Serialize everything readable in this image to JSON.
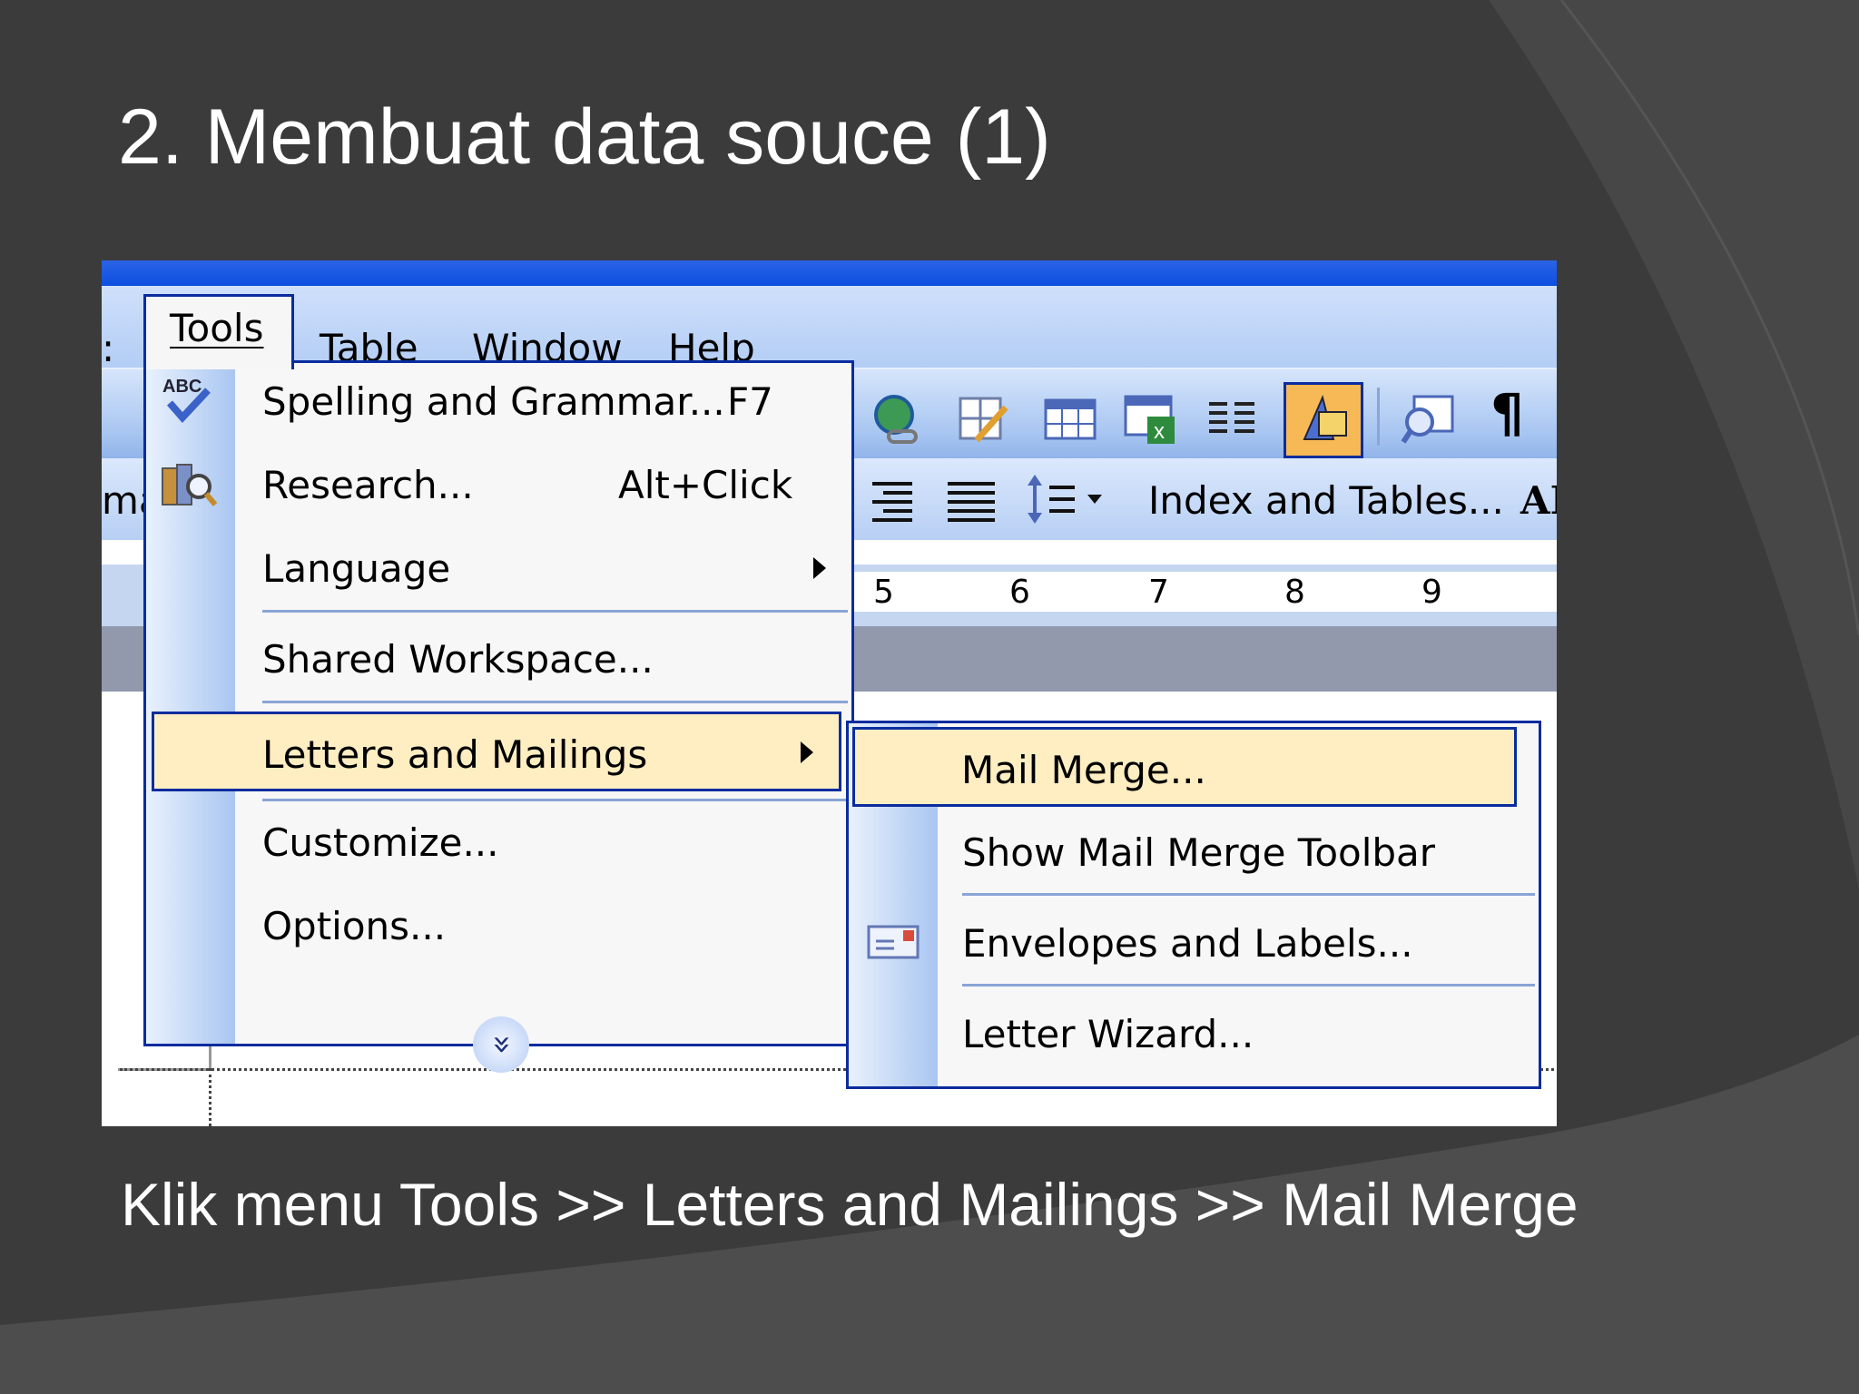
{
  "slide": {
    "title": "2. Membuat data souce (1)",
    "caption": "Klik menu Tools >> Letters and Mailings >> Mail Merge"
  },
  "menubar": {
    "items": [
      {
        "label": "Tools"
      },
      {
        "label": "Table"
      },
      {
        "label": "Window"
      },
      {
        "label": "Help"
      }
    ]
  },
  "tools_menu": {
    "items": [
      {
        "label": "Spelling and Grammar...",
        "shortcut": "F7",
        "icon": "spelling-icon"
      },
      {
        "label": "Research...",
        "shortcut": "Alt+Click",
        "icon": "research-icon"
      },
      {
        "label": "Language",
        "has_submenu": true
      },
      {
        "label": "Shared Workspace..."
      },
      {
        "label": "Letters and Mailings",
        "has_submenu": true,
        "highlighted": true
      },
      {
        "label": "Customize..."
      },
      {
        "label": "Options..."
      }
    ],
    "expand_glyph": "»"
  },
  "submenu": {
    "items": [
      {
        "label": "Mail Merge...",
        "highlighted": true
      },
      {
        "label": "Show Mail Merge Toolbar"
      },
      {
        "label": "Envelopes and Labels...",
        "icon": "envelope-icon"
      },
      {
        "label": "Letter Wizard..."
      }
    ]
  },
  "toolbar": {
    "index_tables_label": "Index and Tables...",
    "pilcrow": "¶",
    "partial_left": "ma",
    "partial_right": "AI",
    "colors": {
      "highlight": "#ffeec2",
      "border": "#0a2c9e",
      "active_button": "#f7b955"
    }
  },
  "ruler": {
    "numbers": [
      "5",
      "6",
      "7",
      "8",
      "9"
    ]
  }
}
